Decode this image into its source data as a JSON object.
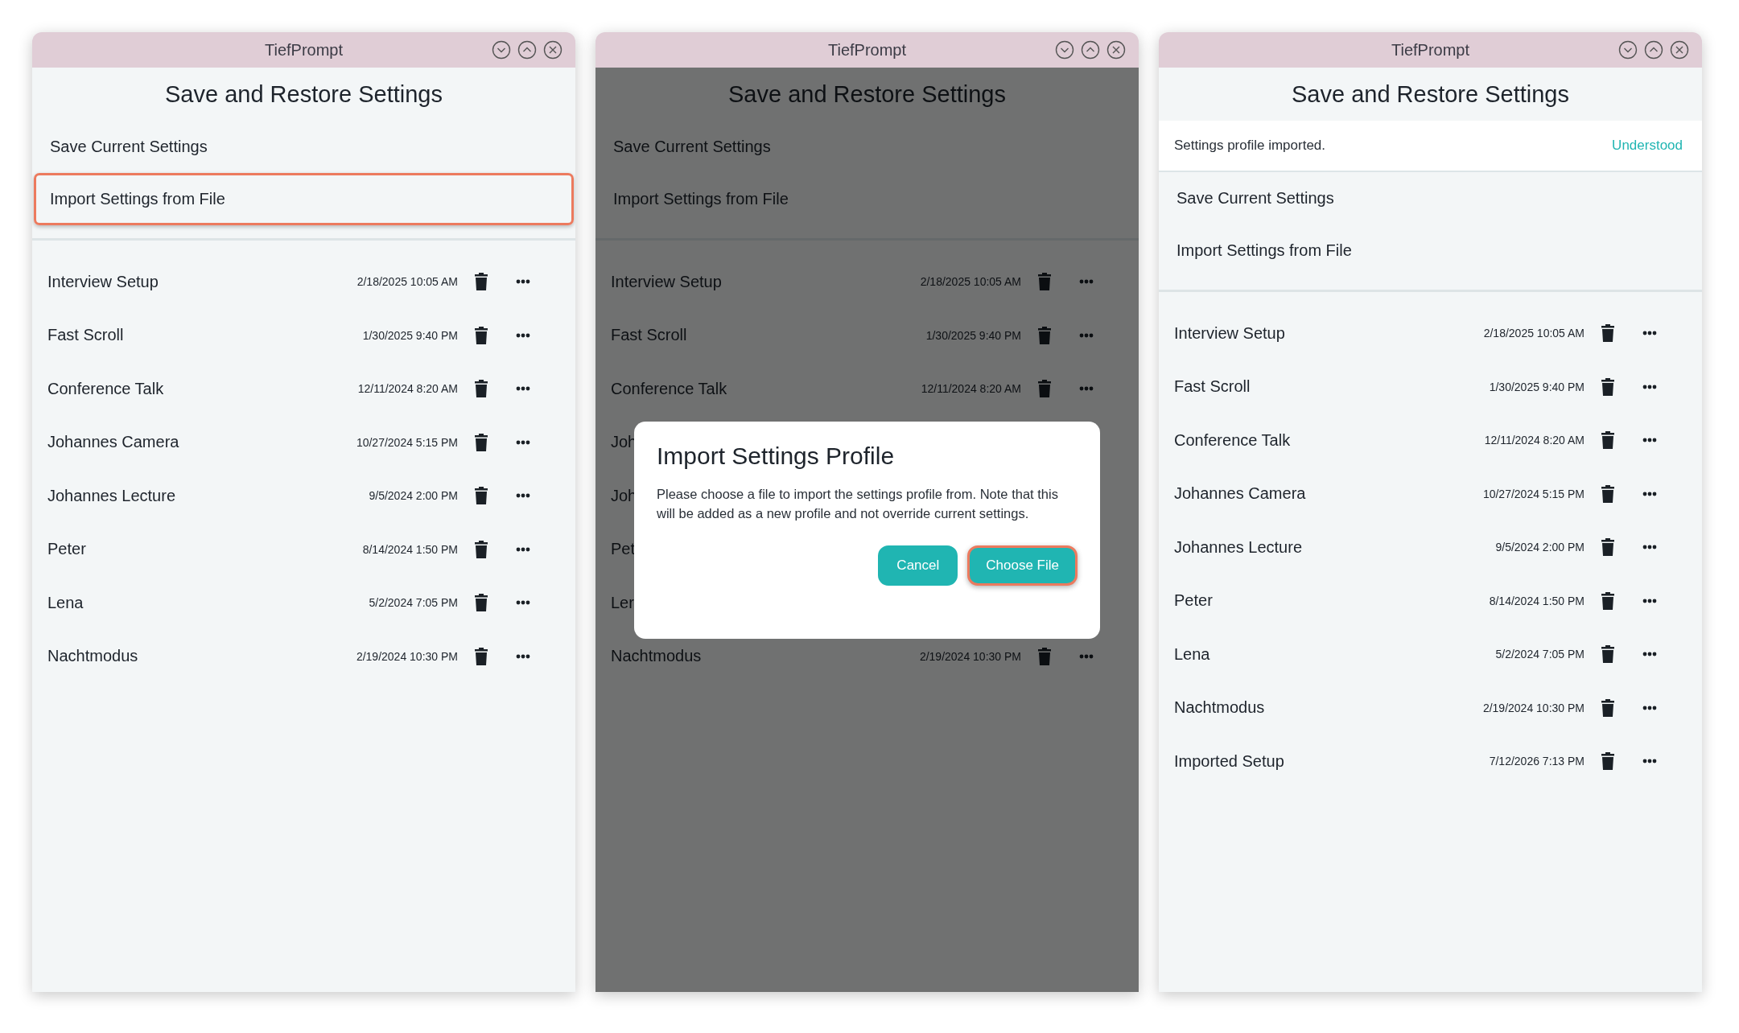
{
  "windows": [
    {
      "title": "TiefPrompt",
      "heading": "Save and Restore Settings",
      "menu": [
        {
          "label": "Save Current Settings",
          "highlighted": false
        },
        {
          "label": "Import Settings from File",
          "highlighted": true
        }
      ],
      "profiles": [
        {
          "name": "Interview Setup",
          "date": "2/18/2025 10:05 AM"
        },
        {
          "name": "Fast Scroll",
          "date": "1/30/2025 9:40 PM"
        },
        {
          "name": "Conference Talk",
          "date": "12/11/2024 8:20 AM"
        },
        {
          "name": "Johannes Camera",
          "date": "10/27/2024 5:15 PM"
        },
        {
          "name": "Johannes Lecture",
          "date": "9/5/2024 2:00 PM"
        },
        {
          "name": "Peter",
          "date": "8/14/2024 1:50 PM"
        },
        {
          "name": "Lena",
          "date": "5/2/2024 7:05 PM"
        },
        {
          "name": "Nachtmodus",
          "date": "2/19/2024 10:30 PM"
        }
      ]
    },
    {
      "title": "TiefPrompt",
      "heading": "Save and Restore Settings",
      "menu": [
        {
          "label": "Save Current Settings",
          "highlighted": false
        },
        {
          "label": "Import Settings from File",
          "highlighted": false
        }
      ],
      "profiles": [
        {
          "name": "Interview Setup",
          "date": "2/18/2025 10:05 AM"
        },
        {
          "name": "Fast Scroll",
          "date": "1/30/2025 9:40 PM"
        },
        {
          "name": "Conference Talk",
          "date": "12/11/2024 8:20 AM"
        },
        {
          "name": "Joh"
        },
        {
          "name": "Joh"
        },
        {
          "name": "Pet"
        },
        {
          "name": "Ler"
        },
        {
          "name": "Nachtmodus",
          "date": "2/19/2024 10:30 PM"
        }
      ],
      "dialog": {
        "title": "Import Settings Profile",
        "text": "Please choose a file to import the settings profile from. Note that this will be added as a new profile and not override current settings.",
        "buttons": [
          {
            "label": "Cancel",
            "highlighted": false
          },
          {
            "label": "Choose File",
            "highlighted": true
          }
        ]
      }
    },
    {
      "title": "TiefPrompt",
      "heading": "Save and Restore Settings",
      "notice": {
        "text": "Settings profile imported.",
        "action": "Understood"
      },
      "menu": [
        {
          "label": "Save Current Settings",
          "highlighted": false
        },
        {
          "label": "Import Settings from File",
          "highlighted": false
        }
      ],
      "profiles": [
        {
          "name": "Interview Setup",
          "date": "2/18/2025 10:05 AM"
        },
        {
          "name": "Fast Scroll",
          "date": "1/30/2025 9:40 PM"
        },
        {
          "name": "Conference Talk",
          "date": "12/11/2024 8:20 AM"
        },
        {
          "name": "Johannes Camera",
          "date": "10/27/2024 5:15 PM"
        },
        {
          "name": "Johannes Lecture",
          "date": "9/5/2024 2:00 PM"
        },
        {
          "name": "Peter",
          "date": "8/14/2024 1:50 PM"
        },
        {
          "name": "Lena",
          "date": "5/2/2024 7:05 PM"
        },
        {
          "name": "Nachtmodus",
          "date": "2/19/2024 10:30 PM"
        },
        {
          "name": "Imported Setup",
          "date": "7/12/2026 7:13 PM"
        }
      ]
    }
  ]
}
